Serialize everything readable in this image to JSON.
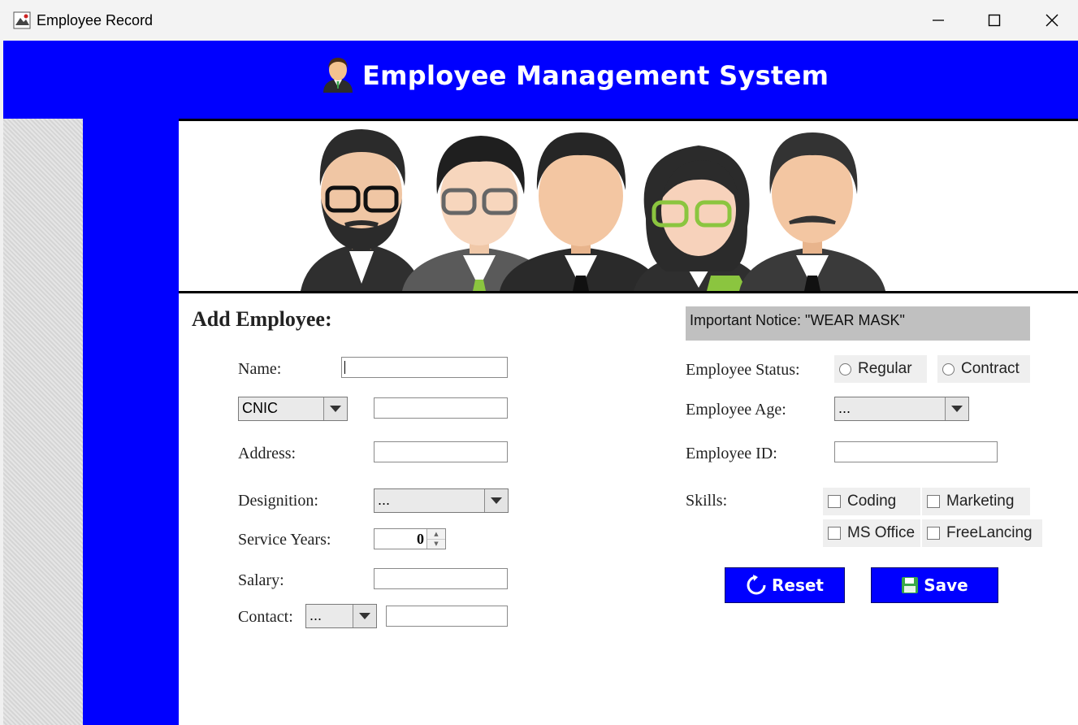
{
  "window": {
    "title": "Employee Record"
  },
  "header": {
    "title": "Employee Management System"
  },
  "form": {
    "heading": "Add Employee:",
    "name_label": "Name:",
    "name_value": "",
    "id_type_selected": "CNIC",
    "id_value": "",
    "address_label": "Address:",
    "address_value": "",
    "designation_label": "Designition:",
    "designation_selected": "...",
    "service_years_label": "Service Years:",
    "service_years_value": "0",
    "salary_label": "Salary:",
    "salary_value": "",
    "contact_label": "Contact:",
    "contact_code_selected": "...",
    "contact_value": ""
  },
  "right_panel": {
    "notice": "Important Notice: \"WEAR MASK\"",
    "status_label": "Employee Status:",
    "status_options": [
      "Regular",
      "Contract"
    ],
    "age_label": "Employee Age:",
    "age_selected": "...",
    "employee_id_label": "Employee ID:",
    "employee_id_value": "",
    "skills_label": "Skills:",
    "skills": [
      "Coding",
      "Marketing",
      "MS Office",
      "FreeLancing"
    ]
  },
  "actions": {
    "reset_label": "Reset",
    "save_label": "Save"
  },
  "colors": {
    "header_blue": "#0000ff",
    "notice_gray": "#c0c0c0",
    "panel_gray": "#dcdcdc"
  },
  "icons": [
    "app-icon",
    "minimize-icon",
    "maximize-icon",
    "close-icon",
    "employee-avatar-icon",
    "reset-icon",
    "save-disk-icon",
    "dropdown-arrow-icon"
  ]
}
